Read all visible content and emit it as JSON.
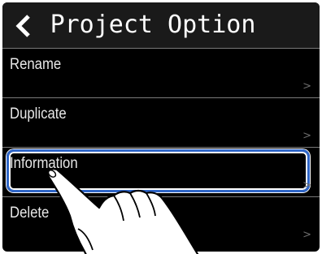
{
  "header": {
    "title": "Project Option",
    "back_icon": "chevron-left-icon"
  },
  "menu": {
    "items": [
      {
        "label": "Rename",
        "arrow": ">"
      },
      {
        "label": "Duplicate",
        "arrow": ">"
      },
      {
        "label": "Information",
        "arrow": ">",
        "selected": true
      },
      {
        "label": "Delete",
        "arrow": ">"
      }
    ]
  },
  "colors": {
    "background": "#000000",
    "header": "#1a1a1a",
    "highlight": "#2f66c8",
    "text": "#e8e8e8"
  }
}
